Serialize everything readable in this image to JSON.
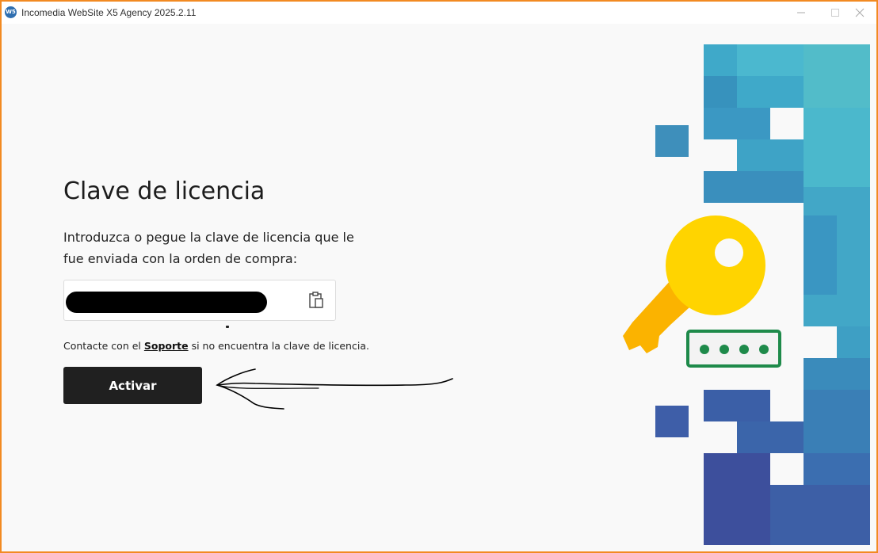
{
  "window": {
    "title": "Incomedia WebSite X5 Agency 2025.2.11",
    "app_icon_text": "W5"
  },
  "main": {
    "heading": "Clave de licencia",
    "description": "Introduzca o pegue la clave de licencia que le fue enviada con la orden de compra:",
    "license_input": {
      "value": ""
    },
    "contact_prefix": "Contacte con el ",
    "contact_link": "Soporte",
    "contact_suffix": " si no encuentra la clave de licencia.",
    "activate_label": "Activar"
  },
  "colors": {
    "accent": "#202020",
    "window_border": "#f28a22",
    "key_yellow": "#ffd400",
    "key_orange": "#fbb300",
    "password_green": "#1e8a4a"
  },
  "icons": {
    "paste": "clipboard-icon",
    "illustration": "license-key-icon"
  }
}
